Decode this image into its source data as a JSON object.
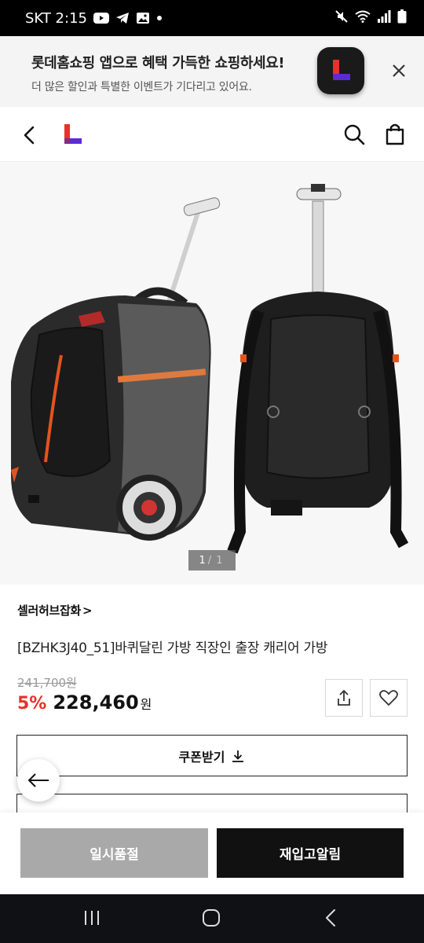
{
  "status_bar": {
    "carrier_time": "SKT 2:15",
    "notification_icons": [
      "youtube-icon",
      "telegram-icon",
      "gallery-icon",
      "dot-icon"
    ],
    "system_icons": [
      "mute-icon",
      "wifi-icon",
      "signal-icon",
      "battery-icon"
    ]
  },
  "app_banner": {
    "title": "롯데홈쇼핑 앱으로 혜택 가득한 쇼핑하세요!",
    "subtitle": "더 많은 할인과 특별한 이벤트가 기다리고 있어요.",
    "logo_letter": "L"
  },
  "header": {
    "logo_letter": "L"
  },
  "product_image": {
    "current": "1",
    "separator": "/",
    "total": "1"
  },
  "product": {
    "seller": "셀러허브잡화",
    "seller_chevron": ">",
    "title": "[BZHK3J40_51]바퀴달린 가방 직장인 출장 캐리어 가방",
    "original_price": "241,700원",
    "discount": "5%",
    "price": "228,460",
    "currency": "원"
  },
  "buttons": {
    "coupon": "쿠폰받기",
    "sold_out": "일시품절",
    "restock_alert": "재입고알림"
  },
  "colors": {
    "accent_red": "#e8312d",
    "logo_purple": "#5b2bd6",
    "soldout_gray": "#a9a9a9",
    "primary_black": "#111111"
  }
}
